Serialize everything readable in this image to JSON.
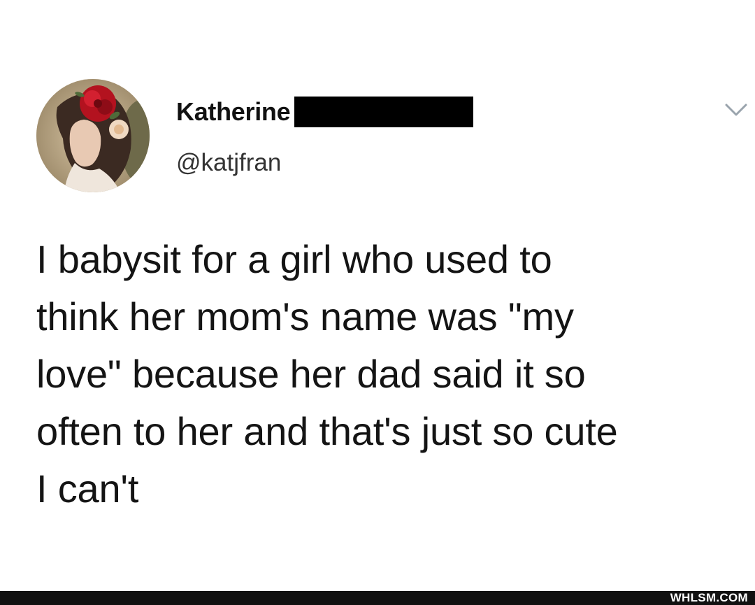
{
  "tweet": {
    "author": {
      "display_name": "Katherine",
      "handle": "@katjfran",
      "avatar": "woman-with-red-flower-photo"
    },
    "menu_icon": "chevron-down-icon",
    "text": "I babysit for a girl who used to\nthink her mom's name was \"my\nlove\" because her dad said it so\noften to her and that's just so cute\nI can't"
  },
  "footer": {
    "watermark": "WHLSM.COM"
  },
  "colors": {
    "background": "#ffffff",
    "text": "#141414",
    "handle": "#333333",
    "redaction": "#000000",
    "footer": "#111111",
    "chevron": "#9aa4ad"
  }
}
